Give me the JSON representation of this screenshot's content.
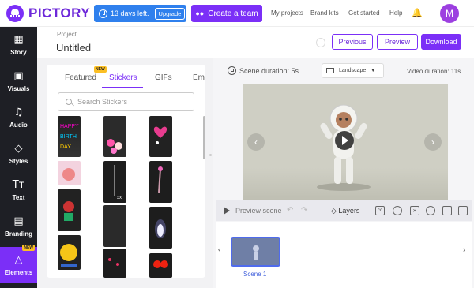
{
  "app": {
    "logo_text": "PICTORY"
  },
  "topbar": {
    "trial_text": "13 days left.",
    "upgrade_label": "Upgrade",
    "team_label": "Create a team",
    "nav": [
      "My projects",
      "Brand kits",
      "Get started",
      "Help"
    ],
    "avatar_initial": "M"
  },
  "sidebar": {
    "items": [
      {
        "label": "Story",
        "icon": "grid-icon"
      },
      {
        "label": "Visuals",
        "icon": "image-icon"
      },
      {
        "label": "Audio",
        "icon": "music-icon"
      },
      {
        "label": "Styles",
        "icon": "styles-icon"
      },
      {
        "label": "Text",
        "icon": "text-icon"
      },
      {
        "label": "Branding",
        "icon": "briefcase-icon"
      },
      {
        "label": "Elements",
        "icon": "shapes-icon",
        "badge": "NEW"
      }
    ]
  },
  "project": {
    "label": "Project",
    "title": "Untitled",
    "previous_label": "Previous",
    "preview_label": "Preview",
    "download_label": "Download"
  },
  "elements_panel": {
    "tabs": [
      "Featured",
      "Stickers",
      "GIFs",
      "Emo"
    ],
    "tab_badge": "NEW",
    "active_tab": "Stickers",
    "search_placeholder": "Search Stickers"
  },
  "stage": {
    "scene_duration": "Scene duration: 5s",
    "aspect": "Landscape",
    "video_duration": "Video duration: 11s",
    "preview_scene": "Preview scene",
    "layers_label": "Layers",
    "toolbar_icons": [
      "cc-icon",
      "mic-icon",
      "scissors-icon",
      "gear-icon",
      "duplicate-icon",
      "trash-icon"
    ]
  },
  "timeline": {
    "scenes": [
      {
        "label": "Scene 1"
      }
    ]
  },
  "colors": {
    "brand": "#7b2ff7",
    "trial_blue": "#2f80ed",
    "sidebar_bg": "#1e1f25"
  }
}
